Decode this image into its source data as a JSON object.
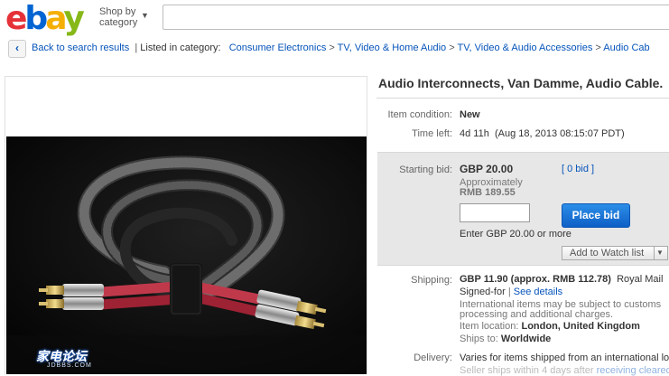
{
  "header": {
    "logo": {
      "e": "e",
      "b": "b",
      "a": "a",
      "y": "y"
    },
    "shop_by": "Shop by category"
  },
  "breadcrumb": {
    "back": "Back to search results",
    "separator": "|",
    "listed_in": "Listed in category:",
    "items": [
      "Consumer Electronics",
      "TV, Video & Home Audio",
      "TV, Video & Audio Accessories",
      "Audio Cab"
    ]
  },
  "item": {
    "title": "Audio Interconnects, Van Damme, Audio Cable.",
    "condition_label": "Item condition:",
    "condition": "New",
    "time_left_label": "Time left:",
    "time_left": "4d 11h",
    "end_time": "(Aug 18, 2013  08:15:07 PDT)"
  },
  "bid": {
    "starting_label": "Starting bid:",
    "price": "GBP 20.00",
    "bid_count": "[ 0 bid ]",
    "approx_label": "Approximately",
    "approx_value": "RMB 189.55",
    "place_bid": "Place bid",
    "hint": "Enter GBP 20.00 or more",
    "watch": "Add to Watch list"
  },
  "shipping": {
    "label": "Shipping:",
    "cost": "GBP 11.90 (approx. RMB 112.78)",
    "service": "Royal Mail",
    "signed": "Signed-for",
    "sep": "|",
    "details": "See details",
    "intl_1": "International items may be subject to customs",
    "intl_2": "processing and additional charges.",
    "location_label": "Item location:",
    "location": "London, United Kingdom",
    "ships_label": "Ships to:",
    "ships_to": "Worldwide"
  },
  "delivery": {
    "label": "Delivery:",
    "text": "Varies for items shipped from an international loca",
    "faded_1": "Seller ships within 4 days after",
    "faded_link": "receiving cleared payi"
  },
  "watermark": {
    "title": "家电论坛",
    "sub": "JDBBS.COM"
  },
  "colors": {
    "link": "#0654ba",
    "place_bid": "#1a73dc",
    "bid_panel": "#e7e7e7"
  }
}
